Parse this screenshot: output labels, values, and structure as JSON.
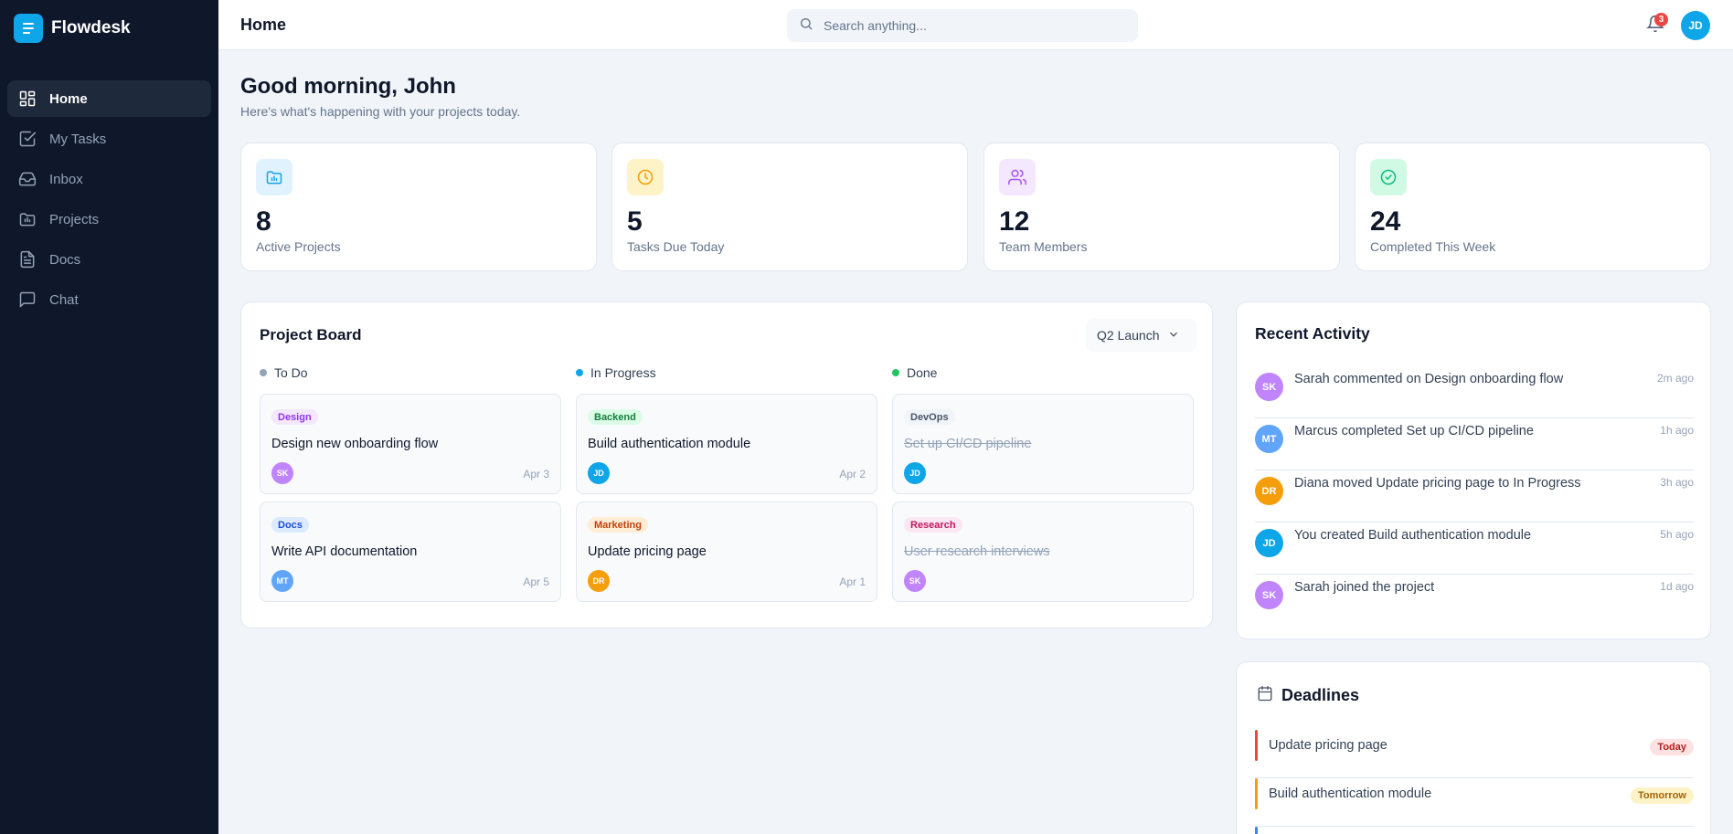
{
  "app": {
    "name": "Flowdesk"
  },
  "sidebar": {
    "items": [
      {
        "label": "Home",
        "icon": "dashboard-icon",
        "active": true
      },
      {
        "label": "My Tasks",
        "icon": "checkbox-icon",
        "active": false
      },
      {
        "label": "Inbox",
        "icon": "inbox-icon",
        "active": false
      },
      {
        "label": "Projects",
        "icon": "folder-icon",
        "active": false
      },
      {
        "label": "Docs",
        "icon": "document-icon",
        "active": false
      },
      {
        "label": "Chat",
        "icon": "chat-icon",
        "active": false
      }
    ]
  },
  "header": {
    "title": "Home",
    "search_placeholder": "Search anything...",
    "notification_count": "3",
    "user_initials": "JD"
  },
  "greeting": {
    "title": "Good morning, John",
    "subtitle": "Here's what's happening with your projects today."
  },
  "stats": [
    {
      "value": "8",
      "label": "Active Projects",
      "icon": "folder-chart-icon",
      "color": "#0ea5e9",
      "bg": "#e0f2fe"
    },
    {
      "value": "5",
      "label": "Tasks Due Today",
      "icon": "clock-icon",
      "color": "#f59e0b",
      "bg": "#fef3c7"
    },
    {
      "value": "12",
      "label": "Team Members",
      "icon": "users-icon",
      "color": "#a855f7",
      "bg": "#f3e8ff"
    },
    {
      "value": "24",
      "label": "Completed This Week",
      "icon": "check-circle-icon",
      "color": "#10b981",
      "bg": "#d1fae5"
    }
  ],
  "board": {
    "title": "Project Board",
    "selected_project": "Q2 Launch",
    "columns": [
      {
        "name": "To Do",
        "color": "#94a3b8",
        "tasks": [
          {
            "tag": "Design",
            "tag_color": "#9333ea",
            "tag_bg": "#f3e8ff",
            "title": "Design new onboarding flow",
            "assignee": "SK",
            "assignee_color": "#c084fc",
            "date": "Apr 3",
            "done": false
          },
          {
            "tag": "Docs",
            "tag_color": "#1d4ed8",
            "tag_bg": "#dbeafe",
            "title": "Write API documentation",
            "assignee": "MT",
            "assignee_color": "#60a5fa",
            "date": "Apr 5",
            "done": false
          }
        ]
      },
      {
        "name": "In Progress",
        "color": "#0ea5e9",
        "tasks": [
          {
            "tag": "Backend",
            "tag_color": "#15803d",
            "tag_bg": "#dcfce7",
            "title": "Build authentication module",
            "assignee": "JD",
            "assignee_color": "#0ea5e9",
            "date": "Apr 2",
            "done": false
          },
          {
            "tag": "Marketing",
            "tag_color": "#c2410c",
            "tag_bg": "#ffedd5",
            "title": "Update pricing page",
            "assignee": "DR",
            "assignee_color": "#f59e0b",
            "date": "Apr 1",
            "done": false
          }
        ]
      },
      {
        "name": "Done",
        "color": "#22c55e",
        "tasks": [
          {
            "tag": "DevOps",
            "tag_color": "#475569",
            "tag_bg": "#f1f5f9",
            "title": "Set up CI/CD pipeline",
            "assignee": "JD",
            "assignee_color": "#0ea5e9",
            "date": "",
            "done": true
          },
          {
            "tag": "Research",
            "tag_color": "#be185d",
            "tag_bg": "#fce7f3",
            "title": "User research interviews",
            "assignee": "SK",
            "assignee_color": "#c084fc",
            "date": "",
            "done": true
          }
        ]
      }
    ]
  },
  "activity": {
    "title": "Recent Activity",
    "items": [
      {
        "initials": "SK",
        "color": "#c084fc",
        "text": "Sarah commented on Design onboarding flow",
        "time": "2m ago"
      },
      {
        "initials": "MT",
        "color": "#60a5fa",
        "text": "Marcus completed Set up CI/CD pipeline",
        "time": "1h ago"
      },
      {
        "initials": "DR",
        "color": "#f59e0b",
        "text": "Diana moved Update pricing page to In Progress",
        "time": "3h ago"
      },
      {
        "initials": "JD",
        "color": "#0ea5e9",
        "text": "You created Build authentication module",
        "time": "5h ago"
      },
      {
        "initials": "SK",
        "color": "#c084fc",
        "text": "Sarah joined the project",
        "time": "1d ago"
      }
    ]
  },
  "deadlines": {
    "title": "Deadlines",
    "items": [
      {
        "name": "Update pricing page",
        "badge": "Today",
        "bar_color": "#ef4444",
        "badge_color": "#b91c1c",
        "badge_bg": "#fee2e2"
      },
      {
        "name": "Build authentication module",
        "badge": "Tomorrow",
        "bar_color": "#f59e0b",
        "badge_color": "#a16207",
        "badge_bg": "#fef3c7"
      },
      {
        "name": "",
        "badge": "",
        "bar_color": "#3b82f6",
        "badge_color": "#1d4ed8",
        "badge_bg": "#dbeafe"
      }
    ]
  }
}
